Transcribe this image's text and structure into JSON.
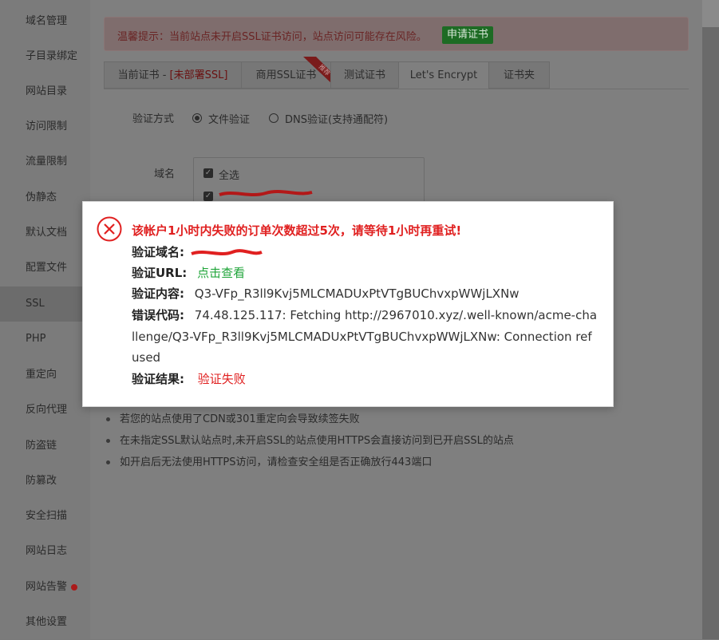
{
  "sidebar": {
    "items": [
      {
        "label": "域名管理"
      },
      {
        "label": "子目录绑定"
      },
      {
        "label": "网站目录"
      },
      {
        "label": "访问限制"
      },
      {
        "label": "流量限制"
      },
      {
        "label": "伪静态"
      },
      {
        "label": "默认文档"
      },
      {
        "label": "配置文件"
      },
      {
        "label": "SSL"
      },
      {
        "label": "PHP"
      },
      {
        "label": "重定向"
      },
      {
        "label": "反向代理"
      },
      {
        "label": "防盗链"
      },
      {
        "label": "防篡改"
      },
      {
        "label": "安全扫描"
      },
      {
        "label": "网站日志"
      },
      {
        "label": "网站告警"
      },
      {
        "label": "其他设置"
      }
    ],
    "active": "SSL"
  },
  "warning": {
    "text": "温馨提示：当前站点未开启SSL证书访问，站点访问可能存在风险。",
    "button": "申请证书"
  },
  "tabs": {
    "current_prefix": "当前证书 - ",
    "current_status": "[未部署SSL]",
    "commercial": "商用SSL证书",
    "ribbon": "推荐",
    "test": "测试证书",
    "letsencrypt": "Let's Encrypt",
    "folder": "证书夹"
  },
  "form": {
    "verify_label": "验证方式",
    "file_verify": "文件验证",
    "dns_verify": "DNS验证(支持通配符)",
    "domain_label": "域名",
    "select_all": "全选"
  },
  "tips": [
    "若您的站点使用了CDN或301重定向会导致续签失败",
    "在未指定SSL默认站点时,未开启SSL的站点使用HTTPS会直接访问到已开启SSL的站点",
    "如开启后无法使用HTTPS访问，请检查安全组是否正确放行443端口"
  ],
  "modal": {
    "title": "该帐户1小时内失败的订单次数超过5次，请等待1小时再重试!",
    "domain_key": "验证域名:",
    "url_key": "验证URL:",
    "url_link": "点击查看",
    "content_key": "验证内容:",
    "content_value": "Q3-VFp_R3ll9Kvj5MLCMADUxPtVTgBUChvxpWWjLXNw",
    "error_key": "错误代码:",
    "error_value": "74.48.125.117: Fetching http://2967010.xyz/.well-known/acme-challenge/Q3-VFp_R3ll9Kvj5MLCMADUxPtVTgBUChvxpWWjLXNw: Connection refused",
    "result_key": "验证结果:",
    "result_value": "验证失败"
  },
  "colors": {
    "error_red": "#e02020",
    "link_green": "#20a53a",
    "button_green": "#20a53a"
  }
}
